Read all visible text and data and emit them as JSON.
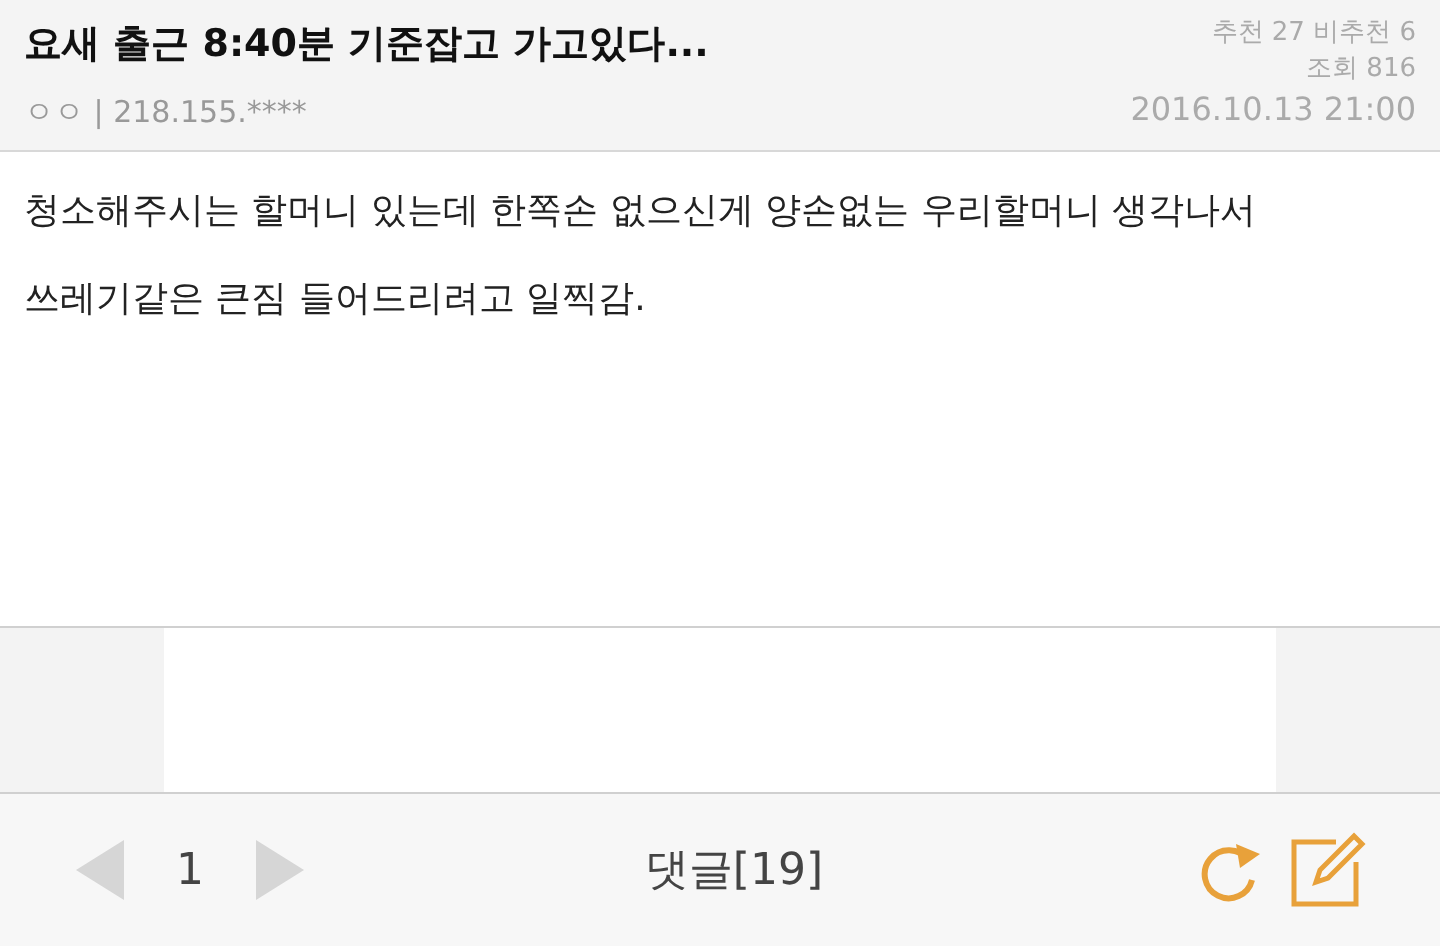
{
  "post": {
    "title": "요새 출근 8:40분 기준잡고 가고있다...",
    "author": "ㅇㅇ | 218.155.****",
    "votes": "추천 27 비추천 6",
    "views": "조회 816",
    "date": "2016.10.13 21:00"
  },
  "body": [
    "청소해주시는 할머니 있는데 한쪽손 없으신게 양손없는 우리할머니 생각나서",
    "쓰레기같은 큰짐 들어드리려고 일찍감."
  ],
  "pager": {
    "page": "1",
    "prev_disabled": true,
    "next_disabled": true
  },
  "comments": "댓글[19]"
}
